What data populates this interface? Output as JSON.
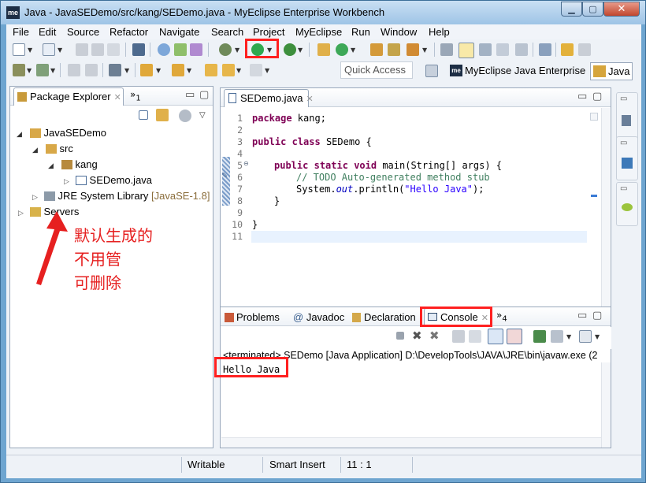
{
  "window": {
    "title": "Java - JavaSEDemo/src/kang/SEDemo.java - MyEclipse Enterprise Workbench",
    "app_icon": "me",
    "min": "▁",
    "max": "▢",
    "close": "✕"
  },
  "menubar": [
    "File",
    "Edit",
    "Source",
    "Refactor",
    "Navigate",
    "Search",
    "Project",
    "MyEclipse",
    "Run",
    "Window",
    "Help"
  ],
  "toolbar": {
    "quick_access_placeholder": "Quick Access",
    "perspective_myeclipse": "MyEclipse Java Enterprise",
    "perspective_java": "Java",
    "me_logo": "me"
  },
  "package_explorer": {
    "tab_label": "Package Explorer",
    "overflow_label": "»",
    "overflow_count": "1",
    "tree": [
      {
        "label": "JavaSEDemo",
        "icon": "project-icon",
        "expander": "◢"
      },
      {
        "label": "src",
        "icon": "source-folder-icon",
        "expander": "◢"
      },
      {
        "label": "kang",
        "icon": "package-icon",
        "expander": "◢"
      },
      {
        "label": "SEDemo.java",
        "icon": "java-file-icon",
        "expander": "▷"
      },
      {
        "label": "JRE System Library",
        "suffix": "[JavaSE-1.8]",
        "icon": "library-icon",
        "expander": "▷"
      },
      {
        "label": "Servers",
        "icon": "folder-icon",
        "expander": "▷"
      }
    ]
  },
  "editor": {
    "tab_label": "SEDemo.java",
    "line_numbers": [
      "1",
      "2",
      "3",
      "4",
      "5",
      "6",
      "7",
      "8",
      "9",
      "10",
      "11"
    ],
    "code": {
      "l1_kw": "package",
      "l1_rest": " kang;",
      "l3_kw1": "public",
      "l3_kw2": "class",
      "l3_rest": " SEDemo {",
      "l5_kw1": "public",
      "l5_kw2": "static",
      "l5_kw3": "void",
      "l5_rest": " main(String[] args) {",
      "l6_comment": "// TODO Auto-generated method stub",
      "l7_a": "System.",
      "l7_b": "out",
      "l7_c": ".println(",
      "l7_d": "\"Hello Java\"",
      "l7_e": ");",
      "l8": "}",
      "l10": "}"
    }
  },
  "bottom_panel": {
    "tabs": [
      "Problems",
      "Javadoc",
      "Declaration",
      "Console"
    ],
    "overflow_label": "»",
    "overflow_count": "4",
    "javadoc_prefix": "@",
    "console_header": "<terminated> SEDemo [Java Application] D:\\DevelopTools\\JAVA\\JRE\\bin\\javaw.exe (2",
    "console_output": "Hello Java"
  },
  "annotation": {
    "line1": "默认生成的",
    "line2": "不用管",
    "line3": "可删除"
  },
  "statusbar": {
    "writable": "Writable",
    "insert_mode": "Smart Insert",
    "position": "11 : 1"
  },
  "colors": {
    "highlight_red": "#ff2020",
    "keyword": "#7f0055",
    "comment": "#3f7f5f",
    "string": "#2a00ff",
    "field": "#0000c0",
    "annotation": "#e62020"
  }
}
